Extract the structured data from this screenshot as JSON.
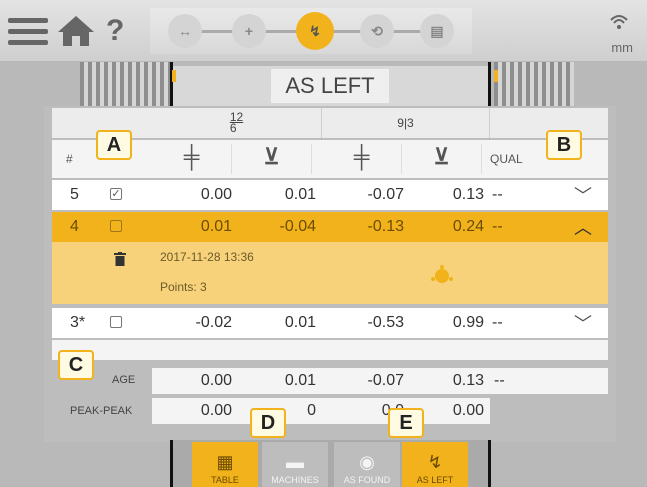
{
  "topbar": {
    "units": "mm",
    "help_label": "?"
  },
  "banner": {
    "title": "AS LEFT"
  },
  "table": {
    "header_groups": [
      {
        "label": "12\n6"
      },
      {
        "label": "9|3"
      }
    ],
    "col_hash": "#",
    "col_quality": "QUAL",
    "rows": [
      {
        "num": "5",
        "checked": "✓",
        "v1": "0.00",
        "v2": "0.01",
        "v3": "-0.07",
        "v4": "0.13",
        "q": "--"
      },
      {
        "num": "4",
        "checked": "",
        "v1": "0.01",
        "v2": "-0.04",
        "v3": "-0.13",
        "v4": "0.24",
        "q": "--"
      },
      {
        "num": "3*",
        "checked": "",
        "v1": "-0.02",
        "v2": "0.01",
        "v3": "-0.53",
        "v4": "0.99",
        "q": "--"
      }
    ],
    "detail": {
      "date": "2017-11-28 13:36",
      "points": "Points: 3"
    },
    "average": {
      "label": "AGE",
      "v1": "0.00",
      "v2": "0.01",
      "v3": "-0.07",
      "v4": "0.13",
      "q": "--"
    },
    "peak": {
      "label": "PEAK-PEAK",
      "v1": "0.00",
      "v2": "0",
      "v3": "0.0",
      "v4": "0.00"
    }
  },
  "bottom_nav": [
    {
      "label": "TABLE",
      "icon": "table-icon",
      "active": true
    },
    {
      "label": "MACHINES",
      "icon": "machines-icon",
      "active": false
    },
    {
      "label": "AS FOUND",
      "icon": "as-found-icon",
      "active": false
    },
    {
      "label": "AS LEFT",
      "icon": "as-left-icon",
      "active": true
    }
  ],
  "callouts": {
    "a": "A",
    "b": "B",
    "c": "C",
    "d": "D",
    "e": "E"
  },
  "colors": {
    "accent": "#f2b21b",
    "highlight_row": "#f2b21b",
    "detail_bg": "#f7d27a"
  }
}
